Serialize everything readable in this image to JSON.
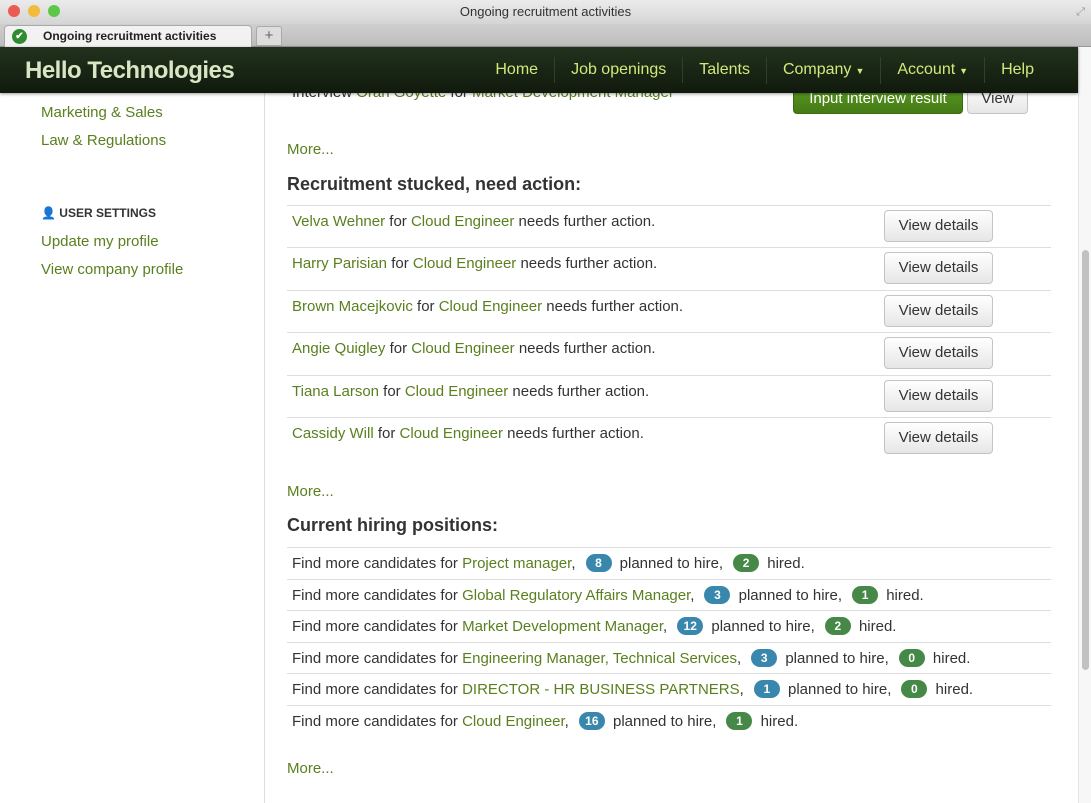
{
  "window": {
    "title": "Ongoing recruitment activities",
    "tab_title": "Ongoing recruitment activities",
    "new_tab": "+"
  },
  "navbar": {
    "brand": "Hello Technologies",
    "items": [
      {
        "label": "Home"
      },
      {
        "label": "Job openings"
      },
      {
        "label": "Talents"
      },
      {
        "label": "Company",
        "dropdown": true
      },
      {
        "label": "Account",
        "dropdown": true
      },
      {
        "label": "Help"
      }
    ]
  },
  "sidebar": {
    "categories": [
      "Marketing & Sales",
      "Law & Regulations"
    ],
    "settings_heading": "USER SETTINGS",
    "settings": [
      "Update my profile",
      "View company profile"
    ]
  },
  "interview": {
    "prefix": "Interview ",
    "candidate": "Oran Goyette",
    "mid": " for ",
    "position": "Market Development Manager",
    "input_button": "Input interview result",
    "view_button": "View",
    "more": "More..."
  },
  "stucked": {
    "heading": "Recruitment stucked, need action:",
    "rows": [
      {
        "name": "Velva Wehner",
        "position": "Cloud Engineer"
      },
      {
        "name": "Harry Parisian",
        "position": "Cloud Engineer"
      },
      {
        "name": "Brown Macejkovic",
        "position": "Cloud Engineer"
      },
      {
        "name": "Angie Quigley",
        "position": "Cloud Engineer"
      },
      {
        "name": "Tiana Larson",
        "position": "Cloud Engineer"
      },
      {
        "name": "Cassidy Will",
        "position": "Cloud Engineer"
      }
    ],
    "for": " for ",
    "suffix": " needs further action.",
    "button": "View details",
    "more": "More..."
  },
  "hiring": {
    "heading": "Current hiring positions:",
    "prefix": "Find more candidates for ",
    "planned_text": " planned to hire,",
    "hired_text": " hired.",
    "rows": [
      {
        "position": "Project manager",
        "planned": "8",
        "hired": "2"
      },
      {
        "position": "Global Regulatory Affairs Manager",
        "planned": "3",
        "hired": "1"
      },
      {
        "position": "Market Development Manager",
        "planned": "12",
        "hired": "2"
      },
      {
        "position": "Engineering Manager, Technical Services",
        "planned": "3",
        "hired": "0"
      },
      {
        "position": "DIRECTOR - HR BUSINESS PARTNERS",
        "planned": "1",
        "hired": "0"
      },
      {
        "position": "Cloud Engineer",
        "planned": "16",
        "hired": "1"
      }
    ],
    "more": "More..."
  },
  "colors": {
    "link": "#5a7f1e",
    "nav_bg": "#1b2a17",
    "nav_link": "#d2e87a",
    "badge_planned": "#3a87ad",
    "badge_hired": "#468847",
    "primary_button": "#4f8a1c"
  }
}
